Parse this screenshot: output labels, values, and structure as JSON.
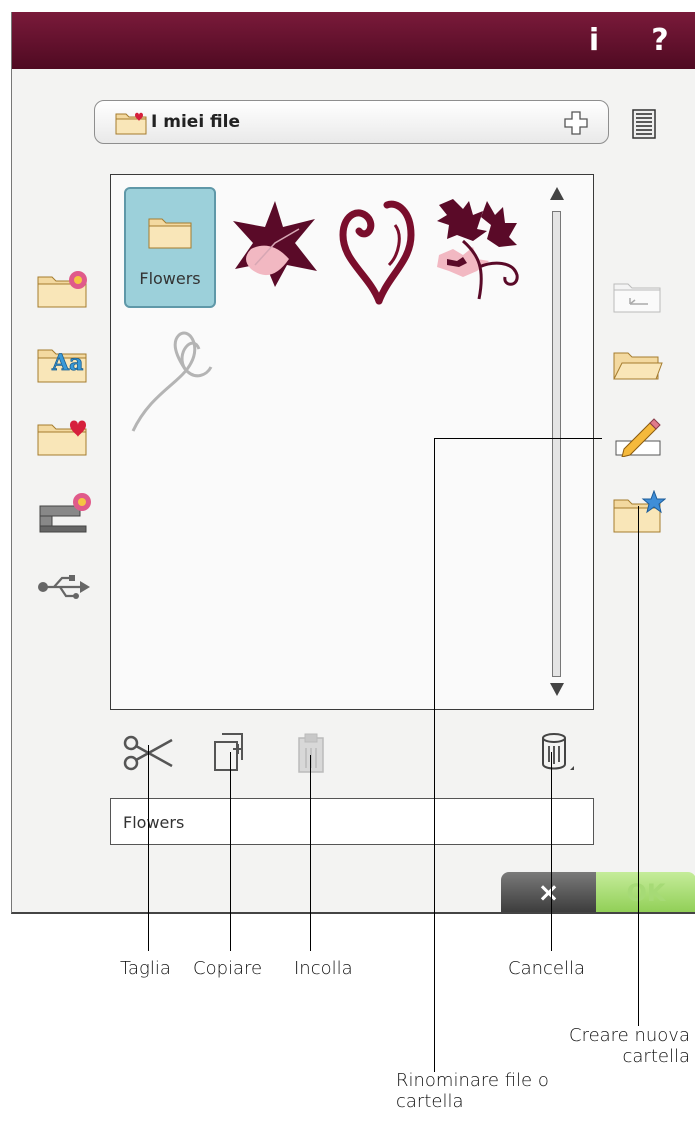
{
  "titlebar": {
    "info_label": "i",
    "help_label": "?"
  },
  "location": {
    "label": "I miei file"
  },
  "file_grid": {
    "items": [
      {
        "name": "Flowers",
        "type": "folder",
        "selected": true
      },
      {
        "name": "",
        "type": "design",
        "icon": "leaf-design-icon"
      },
      {
        "name": "",
        "type": "design",
        "icon": "heart-swirl-design-icon"
      },
      {
        "name": "",
        "type": "design",
        "icon": "oak-leaves-design-icon"
      },
      {
        "name": "",
        "type": "design",
        "icon": "heart-ribbon-design-icon"
      }
    ]
  },
  "left_nav": [
    {
      "icon": "flower-folder-icon"
    },
    {
      "icon": "font-folder-icon"
    },
    {
      "icon": "my-files-folder-icon"
    },
    {
      "icon": "machine-folder-icon"
    },
    {
      "icon": "usb-icon"
    }
  ],
  "right_actions": [
    {
      "icon": "folder-up-icon",
      "enabled": false
    },
    {
      "icon": "open-folder-icon"
    },
    {
      "icon": "rename-pencil-icon"
    },
    {
      "icon": "new-folder-icon"
    }
  ],
  "toolbar": [
    {
      "icon": "scissors-icon"
    },
    {
      "icon": "copy-icon"
    },
    {
      "icon": "paste-icon",
      "enabled": false
    },
    {
      "icon": "trash-icon"
    }
  ],
  "name_field": {
    "value": "Flowers"
  },
  "buttons": {
    "cancel_label": "×",
    "ok_label": "OK"
  },
  "callouts": {
    "cut": "Taglia",
    "copy": "Copiare",
    "paste": "Incolla",
    "delete": "Cancella",
    "new_folder_line1": "Creare nuova",
    "new_folder_line2": "cartella",
    "rename_line1": "Rinominare file o",
    "rename_line2": "cartella"
  },
  "colors": {
    "titlebar": "#5e0f2c",
    "selection": "#9cd0da",
    "ok_button": "#9bd46a",
    "cancel_button": "#4a4a4a",
    "design_primary": "#5a0a28"
  }
}
